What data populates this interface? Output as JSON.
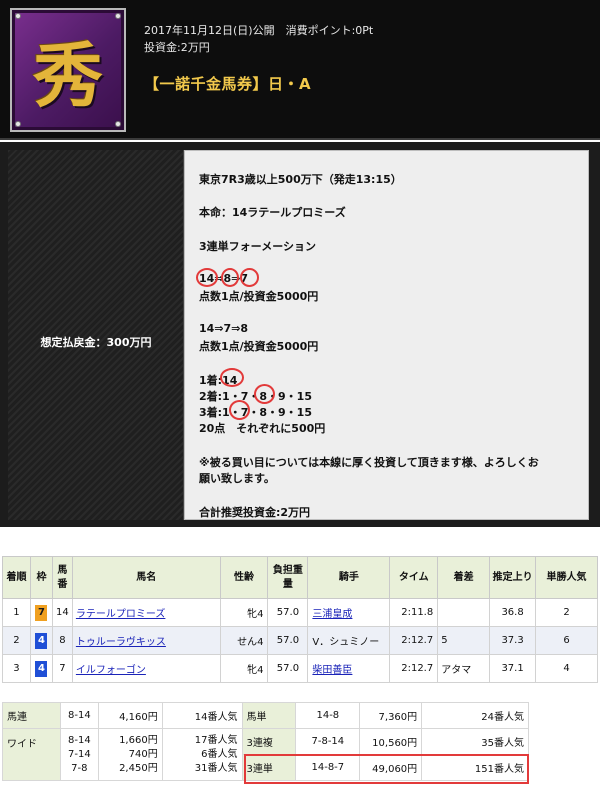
{
  "header": {
    "logo_char": "秀",
    "date_line": "2017年11月12日(日)公開　消費ポイント:0Pt",
    "fund_line": "投資金:2万円",
    "title": "【一諾千金馬券】日・A"
  },
  "panel": {
    "payout_label": "想定払戻金：300万円",
    "lines": [
      "東京7R3歳以上500万下（発走13:15）",
      "本命：14ラテールプロミーズ",
      "3連単フォーメーション",
      "14⇒8⇒7",
      "点数1点/投資金5000円",
      "14⇒7⇒8",
      "点数1点/投資金5000円",
      "1着:14",
      "2着:1・7・8・9・15",
      "3着:1・7・8・9・15",
      "20点　それぞれに500円",
      "※被る買い目については本線に厚く投資して頂きます様、よろしくお",
      "願い致します。",
      "合計推奨投資金:2万円"
    ]
  },
  "result_table": {
    "headers": [
      "着順",
      "枠",
      "馬番",
      "馬名",
      "性齢",
      "負担重量",
      "騎手",
      "タイム",
      "着差",
      "推定上り",
      "単勝人気"
    ],
    "rows": [
      {
        "rank": "1",
        "waku": "7",
        "num": "14",
        "name": "ラテールプロミーズ",
        "sex_age": "牝4",
        "weight": "57.0",
        "jockey": "三浦皇成",
        "time": "2:11.8",
        "margin": "",
        "last3f": "36.8",
        "pop": "2"
      },
      {
        "rank": "2",
        "waku": "4",
        "num": "8",
        "name": "トゥルーラヴキッス",
        "sex_age": "せん4",
        "weight": "57.0",
        "jockey": "V．シュミノー",
        "time": "2:12.7",
        "margin": "5",
        "last3f": "37.3",
        "pop": "6"
      },
      {
        "rank": "3",
        "waku": "4",
        "num": "7",
        "name": "イルフォーゴン",
        "sex_age": "牝4",
        "weight": "57.0",
        "jockey": "柴田善臣",
        "time": "2:12.7",
        "margin": "アタマ",
        "last3f": "37.1",
        "pop": "4"
      }
    ]
  },
  "payout_table": {
    "umaren": {
      "label": "馬連",
      "combo": "8-14",
      "amount": "4,160円",
      "pop": "14番人気"
    },
    "wide": {
      "label": "ワイド",
      "combos": [
        "8-14",
        "7-14",
        "7-8"
      ],
      "amounts": [
        "1,660円",
        "740円",
        "2,450円"
      ],
      "pops": [
        "17番人気",
        "6番人気",
        "31番人気"
      ]
    },
    "umatan": {
      "label": "馬単",
      "combo": "14-8",
      "amount": "7,360円",
      "pop": "24番人気"
    },
    "sanrenpuku": {
      "label": "3連複",
      "combo": "7-8-14",
      "amount": "10,560円",
      "pop": "35番人気"
    },
    "sanrentan": {
      "label": "3連単",
      "combo": "14-8-7",
      "amount": "49,060円",
      "pop": "151番人気"
    }
  },
  "colors": {
    "waku7": "#f0a020",
    "waku4": "#1f4fd6",
    "highlight": "#e23a3a",
    "title": "#f2c94c"
  }
}
